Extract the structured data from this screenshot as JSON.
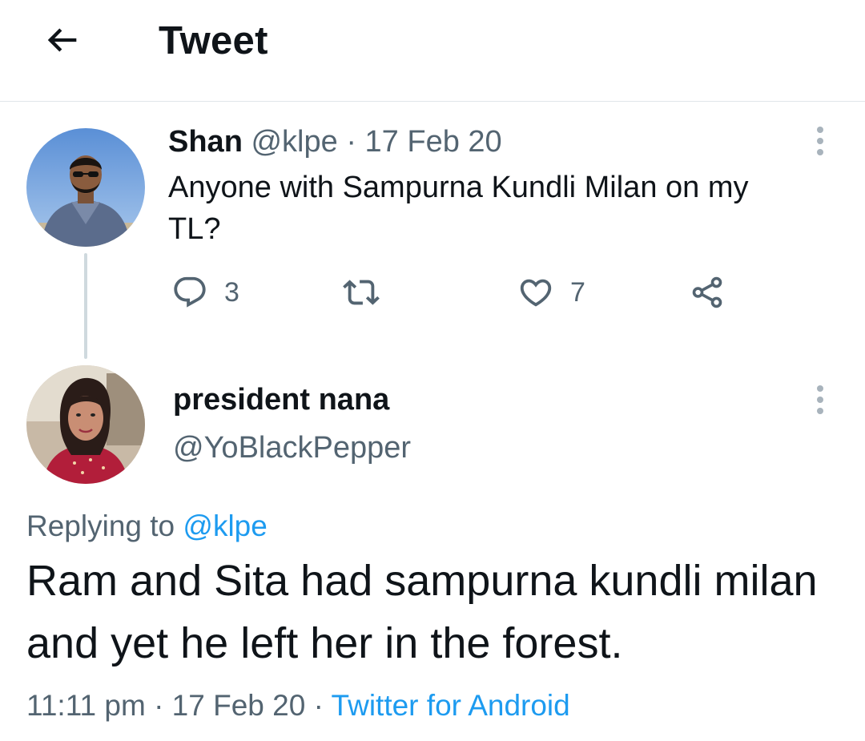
{
  "header": {
    "title": "Tweet",
    "back_icon": "arrow-left-icon"
  },
  "parent_tweet": {
    "author_name": "Shan",
    "author_handle": "@klpe",
    "separator": "·",
    "date": "17 Feb 20",
    "text": "Anyone with Sampurna Kundli Milan on my TL?",
    "actions": {
      "reply_count": "3",
      "retweet_count": "",
      "like_count": "7"
    }
  },
  "reply_tweet": {
    "author_name": "president nana",
    "author_handle": "@YoBlackPepper",
    "replying_prefix": "Replying to ",
    "replying_to": "@klpe",
    "text": "Ram and Sita had sampurna kundli milan and yet he left her in the forest.",
    "time": "11:11 pm",
    "separator": "·",
    "date": "17 Feb 20",
    "source": "Twitter for Android"
  },
  "colors": {
    "link": "#1d9bf0",
    "muted": "#536471",
    "text": "#0f1419",
    "divider": "#e1e6ea"
  }
}
